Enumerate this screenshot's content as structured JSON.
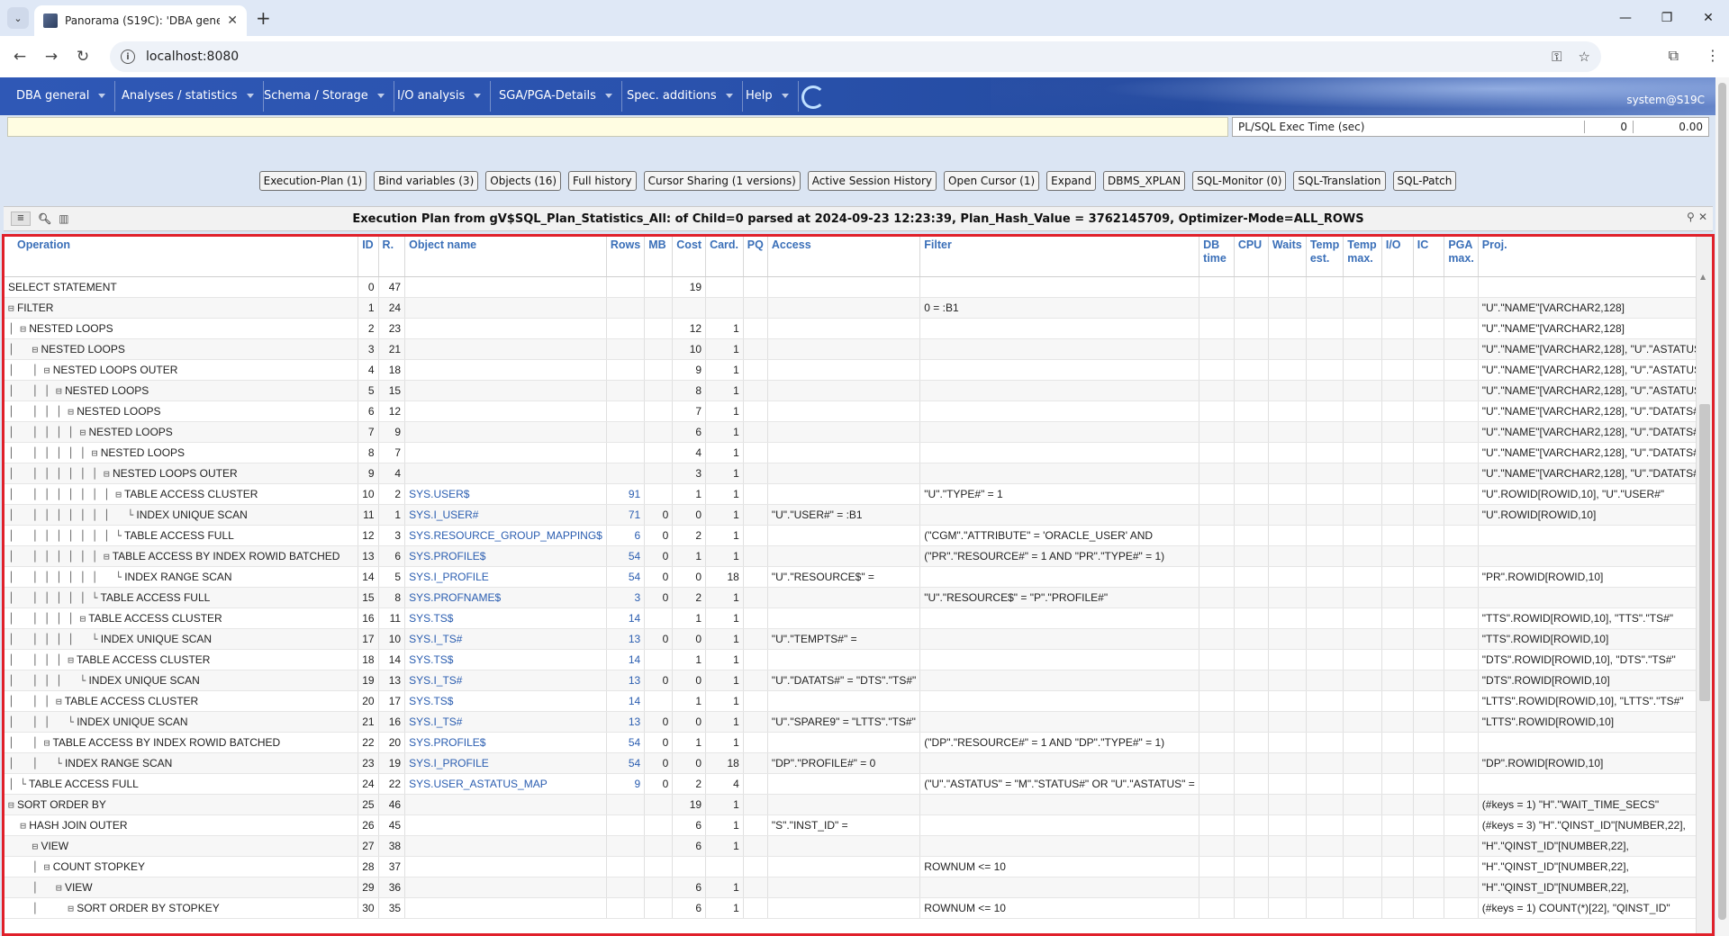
{
  "browser": {
    "tab_title": "Panorama (S19C): 'DBA genera",
    "url": "localhost:8080"
  },
  "menu": {
    "items": [
      "DBA general",
      "Analyses / statistics",
      "Schema / Storage",
      "I/O analysis",
      "SGA/PGA-Details",
      "Spec. additions",
      "Help"
    ],
    "user": "system@S19C"
  },
  "info": {
    "plsql_label": "PL/SQL Exec Time (sec)",
    "plsql_count": "0",
    "plsql_time": "0.00"
  },
  "buttons": [
    "Execution-Plan (1)",
    "Bind variables (3)",
    "Objects (16)",
    "Full history",
    "Cursor Sharing (1 versions)",
    "Active Session History",
    "Open Cursor (1)",
    "Expand",
    "DBMS_XPLAN",
    "SQL-Monitor (0)",
    "SQL-Translation",
    "SQL-Patch"
  ],
  "grid": {
    "title": "Execution Plan from gV$SQL_Plan_Statistics_All: of Child=0 parsed at 2024-09-23 12:23:39, Plan_Hash_Value = 3762145709, Optimizer-Mode=ALL_ROWS",
    "columns": [
      "Operation",
      "ID",
      "R.",
      "Object name",
      "Rows",
      "MB",
      "Cost",
      "Card.",
      "PQ",
      "Access",
      "Filter",
      "DB time",
      "CPU",
      "Waits",
      "Temp est.",
      "Temp max.",
      "I/O",
      "IC",
      "PGA max.",
      "Proj."
    ],
    "rows": [
      {
        "tree": "",
        "op": "SELECT STATEMENT",
        "id": "0",
        "r": "47",
        "obj": "",
        "rows": "",
        "mb": "",
        "cost": "19",
        "card": "",
        "access": "",
        "filter": "",
        "proj": ""
      },
      {
        "tree": "⊟",
        "op": "FILTER",
        "id": "1",
        "r": "24",
        "obj": "",
        "rows": "",
        "mb": "",
        "cost": "",
        "card": "",
        "access": "",
        "filter": "0 = :B1",
        "proj": "\"U\".\"NAME\"[VARCHAR2,128]"
      },
      {
        "tree": "│ ⊟",
        "op": "NESTED LOOPS",
        "id": "2",
        "r": "23",
        "obj": "",
        "rows": "",
        "mb": "",
        "cost": "12",
        "card": "1",
        "access": "",
        "filter": "",
        "proj": "\"U\".\"NAME\"[VARCHAR2,128]"
      },
      {
        "tree": "│   ⊟",
        "op": "NESTED LOOPS",
        "id": "3",
        "r": "21",
        "obj": "",
        "rows": "",
        "mb": "",
        "cost": "10",
        "card": "1",
        "access": "",
        "filter": "",
        "proj": "\"U\".\"NAME\"[VARCHAR2,128], \"U\".\"ASTATUS\""
      },
      {
        "tree": "│   │ ⊟",
        "op": "NESTED LOOPS OUTER",
        "id": "4",
        "r": "18",
        "obj": "",
        "rows": "",
        "mb": "",
        "cost": "9",
        "card": "1",
        "access": "",
        "filter": "",
        "proj": "\"U\".\"NAME\"[VARCHAR2,128], \"U\".\"ASTATUS\""
      },
      {
        "tree": "│   │ │ ⊟",
        "op": "NESTED LOOPS",
        "id": "5",
        "r": "15",
        "obj": "",
        "rows": "",
        "mb": "",
        "cost": "8",
        "card": "1",
        "access": "",
        "filter": "",
        "proj": "\"U\".\"NAME\"[VARCHAR2,128], \"U\".\"ASTATUS\""
      },
      {
        "tree": "│   │ │ │ ⊟",
        "op": "NESTED LOOPS",
        "id": "6",
        "r": "12",
        "obj": "",
        "rows": "",
        "mb": "",
        "cost": "7",
        "card": "1",
        "access": "",
        "filter": "",
        "proj": "\"U\".\"NAME\"[VARCHAR2,128], \"U\".\"DATATS#\""
      },
      {
        "tree": "│   │ │ │ │ ⊟",
        "op": "NESTED LOOPS",
        "id": "7",
        "r": "9",
        "obj": "",
        "rows": "",
        "mb": "",
        "cost": "6",
        "card": "1",
        "access": "",
        "filter": "",
        "proj": "\"U\".\"NAME\"[VARCHAR2,128], \"U\".\"DATATS#\""
      },
      {
        "tree": "│   │ │ │ │ │ ⊟",
        "op": "NESTED LOOPS",
        "id": "8",
        "r": "7",
        "obj": "",
        "rows": "",
        "mb": "",
        "cost": "4",
        "card": "1",
        "access": "",
        "filter": "",
        "proj": "\"U\".\"NAME\"[VARCHAR2,128], \"U\".\"DATATS#\""
      },
      {
        "tree": "│   │ │ │ │ │ │ ⊟",
        "op": "NESTED LOOPS OUTER",
        "id": "9",
        "r": "4",
        "obj": "",
        "rows": "",
        "mb": "",
        "cost": "3",
        "card": "1",
        "access": "",
        "filter": "",
        "proj": "\"U\".\"NAME\"[VARCHAR2,128], \"U\".\"DATATS#\""
      },
      {
        "tree": "│   │ │ │ │ │ │ │ ⊟",
        "op": "TABLE ACCESS CLUSTER",
        "id": "10",
        "r": "2",
        "obj": "SYS.USER$",
        "rows": "91",
        "mb": "",
        "cost": "1",
        "card": "1",
        "access": "",
        "filter": "\"U\".\"TYPE#\" = 1",
        "proj": "\"U\".ROWID[ROWID,10], \"U\".\"USER#\""
      },
      {
        "tree": "│   │ │ │ │ │ │ │   └",
        "op": "INDEX UNIQUE SCAN",
        "id": "11",
        "r": "1",
        "obj": "SYS.I_USER#",
        "rows": "71",
        "mb": "0",
        "cost": "0",
        "card": "1",
        "access": "\"U\".\"USER#\" = :B1",
        "filter": "",
        "proj": "\"U\".ROWID[ROWID,10]"
      },
      {
        "tree": "│   │ │ │ │ │ │ │ └",
        "op": "TABLE ACCESS FULL",
        "id": "12",
        "r": "3",
        "obj": "SYS.RESOURCE_GROUP_MAPPING$",
        "rows": "6",
        "mb": "0",
        "cost": "2",
        "card": "1",
        "access": "",
        "filter": "(\"CGM\".\"ATTRIBUTE\" = 'ORACLE_USER' AND",
        "proj": ""
      },
      {
        "tree": "│   │ │ │ │ │ │ ⊟",
        "op": "TABLE ACCESS BY INDEX ROWID BATCHED",
        "id": "13",
        "r": "6",
        "obj": "SYS.PROFILE$",
        "rows": "54",
        "mb": "0",
        "cost": "1",
        "card": "1",
        "access": "",
        "filter": "(\"PR\".\"RESOURCE#\" = 1 AND \"PR\".\"TYPE#\" = 1)",
        "proj": ""
      },
      {
        "tree": "│   │ │ │ │ │ │   └",
        "op": "INDEX RANGE SCAN",
        "id": "14",
        "r": "5",
        "obj": "SYS.I_PROFILE",
        "rows": "54",
        "mb": "0",
        "cost": "0",
        "card": "18",
        "access": "\"U\".\"RESOURCE$\" =",
        "filter": "",
        "proj": "\"PR\".ROWID[ROWID,10]"
      },
      {
        "tree": "│   │ │ │ │ │ └",
        "op": "TABLE ACCESS FULL",
        "id": "15",
        "r": "8",
        "obj": "SYS.PROFNAME$",
        "rows": "3",
        "mb": "0",
        "cost": "2",
        "card": "1",
        "access": "",
        "filter": "\"U\".\"RESOURCE$\" = \"P\".\"PROFILE#\"",
        "proj": ""
      },
      {
        "tree": "│   │ │ │ │ ⊟",
        "op": "TABLE ACCESS CLUSTER",
        "id": "16",
        "r": "11",
        "obj": "SYS.TS$",
        "rows": "14",
        "mb": "",
        "cost": "1",
        "card": "1",
        "access": "",
        "filter": "",
        "proj": "\"TTS\".ROWID[ROWID,10], \"TTS\".\"TS#\""
      },
      {
        "tree": "│   │ │ │ │   └",
        "op": "INDEX UNIQUE SCAN",
        "id": "17",
        "r": "10",
        "obj": "SYS.I_TS#",
        "rows": "13",
        "mb": "0",
        "cost": "0",
        "card": "1",
        "access": "\"U\".\"TEMPTS#\" =",
        "filter": "",
        "proj": "\"TTS\".ROWID[ROWID,10]"
      },
      {
        "tree": "│   │ │ │ ⊟",
        "op": "TABLE ACCESS CLUSTER",
        "id": "18",
        "r": "14",
        "obj": "SYS.TS$",
        "rows": "14",
        "mb": "",
        "cost": "1",
        "card": "1",
        "access": "",
        "filter": "",
        "proj": "\"DTS\".ROWID[ROWID,10], \"DTS\".\"TS#\""
      },
      {
        "tree": "│   │ │ │   └",
        "op": "INDEX UNIQUE SCAN",
        "id": "19",
        "r": "13",
        "obj": "SYS.I_TS#",
        "rows": "13",
        "mb": "0",
        "cost": "0",
        "card": "1",
        "access": "\"U\".\"DATATS#\" = \"DTS\".\"TS#\"",
        "filter": "",
        "proj": "\"DTS\".ROWID[ROWID,10]"
      },
      {
        "tree": "│   │ │ ⊟",
        "op": "TABLE ACCESS CLUSTER",
        "id": "20",
        "r": "17",
        "obj": "SYS.TS$",
        "rows": "14",
        "mb": "",
        "cost": "1",
        "card": "1",
        "access": "",
        "filter": "",
        "proj": "\"LTTS\".ROWID[ROWID,10], \"LTTS\".\"TS#\""
      },
      {
        "tree": "│   │ │   └",
        "op": "INDEX UNIQUE SCAN",
        "id": "21",
        "r": "16",
        "obj": "SYS.I_TS#",
        "rows": "13",
        "mb": "0",
        "cost": "0",
        "card": "1",
        "access": "\"U\".\"SPARE9\" = \"LTTS\".\"TS#\"",
        "filter": "",
        "proj": "\"LTTS\".ROWID[ROWID,10]"
      },
      {
        "tree": "│   │ ⊟",
        "op": "TABLE ACCESS BY INDEX ROWID BATCHED",
        "id": "22",
        "r": "20",
        "obj": "SYS.PROFILE$",
        "rows": "54",
        "mb": "0",
        "cost": "1",
        "card": "1",
        "access": "",
        "filter": "(\"DP\".\"RESOURCE#\" = 1 AND \"DP\".\"TYPE#\" = 1)",
        "proj": ""
      },
      {
        "tree": "│   │   └",
        "op": "INDEX RANGE SCAN",
        "id": "23",
        "r": "19",
        "obj": "SYS.I_PROFILE",
        "rows": "54",
        "mb": "0",
        "cost": "0",
        "card": "18",
        "access": "\"DP\".\"PROFILE#\" = 0",
        "filter": "",
        "proj": "\"DP\".ROWID[ROWID,10]"
      },
      {
        "tree": "│ └",
        "op": "TABLE ACCESS FULL",
        "id": "24",
        "r": "22",
        "obj": "SYS.USER_ASTATUS_MAP",
        "rows": "9",
        "mb": "0",
        "cost": "2",
        "card": "4",
        "access": "",
        "filter": "(\"U\".\"ASTATUS\" = \"M\".\"STATUS#\" OR \"U\".\"ASTATUS\" =",
        "proj": ""
      },
      {
        "tree": "⊟",
        "op": "SORT ORDER BY",
        "id": "25",
        "r": "46",
        "obj": "",
        "rows": "",
        "mb": "",
        "cost": "19",
        "card": "1",
        "access": "",
        "filter": "",
        "proj": "(#keys = 1) \"H\".\"WAIT_TIME_SECS\""
      },
      {
        "tree": "  ⊟",
        "op": "HASH JOIN OUTER",
        "id": "26",
        "r": "45",
        "obj": "",
        "rows": "",
        "mb": "",
        "cost": "6",
        "card": "1",
        "access": "\"S\".\"INST_ID\" =",
        "filter": "",
        "proj": "(#keys = 3) \"H\".\"QINST_ID\"[NUMBER,22],"
      },
      {
        "tree": "    ⊟",
        "op": "VIEW",
        "id": "27",
        "r": "38",
        "obj": "",
        "rows": "",
        "mb": "",
        "cost": "6",
        "card": "1",
        "access": "",
        "filter": "",
        "proj": "\"H\".\"QINST_ID\"[NUMBER,22],"
      },
      {
        "tree": "    │ ⊟",
        "op": "COUNT STOPKEY",
        "id": "28",
        "r": "37",
        "obj": "",
        "rows": "",
        "mb": "",
        "cost": "",
        "card": "",
        "access": "",
        "filter": "ROWNUM <= 10",
        "proj": "\"H\".\"QINST_ID\"[NUMBER,22],"
      },
      {
        "tree": "    │   ⊟",
        "op": "VIEW",
        "id": "29",
        "r": "36",
        "obj": "",
        "rows": "",
        "mb": "",
        "cost": "6",
        "card": "1",
        "access": "",
        "filter": "",
        "proj": "\"H\".\"QINST_ID\"[NUMBER,22],"
      },
      {
        "tree": "    │     ⊟",
        "op": "SORT ORDER BY STOPKEY",
        "id": "30",
        "r": "35",
        "obj": "",
        "rows": "",
        "mb": "",
        "cost": "6",
        "card": "1",
        "access": "",
        "filter": "ROWNUM <= 10",
        "proj": "(#keys = 1) COUNT(*)[22], \"QINST_ID\""
      }
    ]
  }
}
